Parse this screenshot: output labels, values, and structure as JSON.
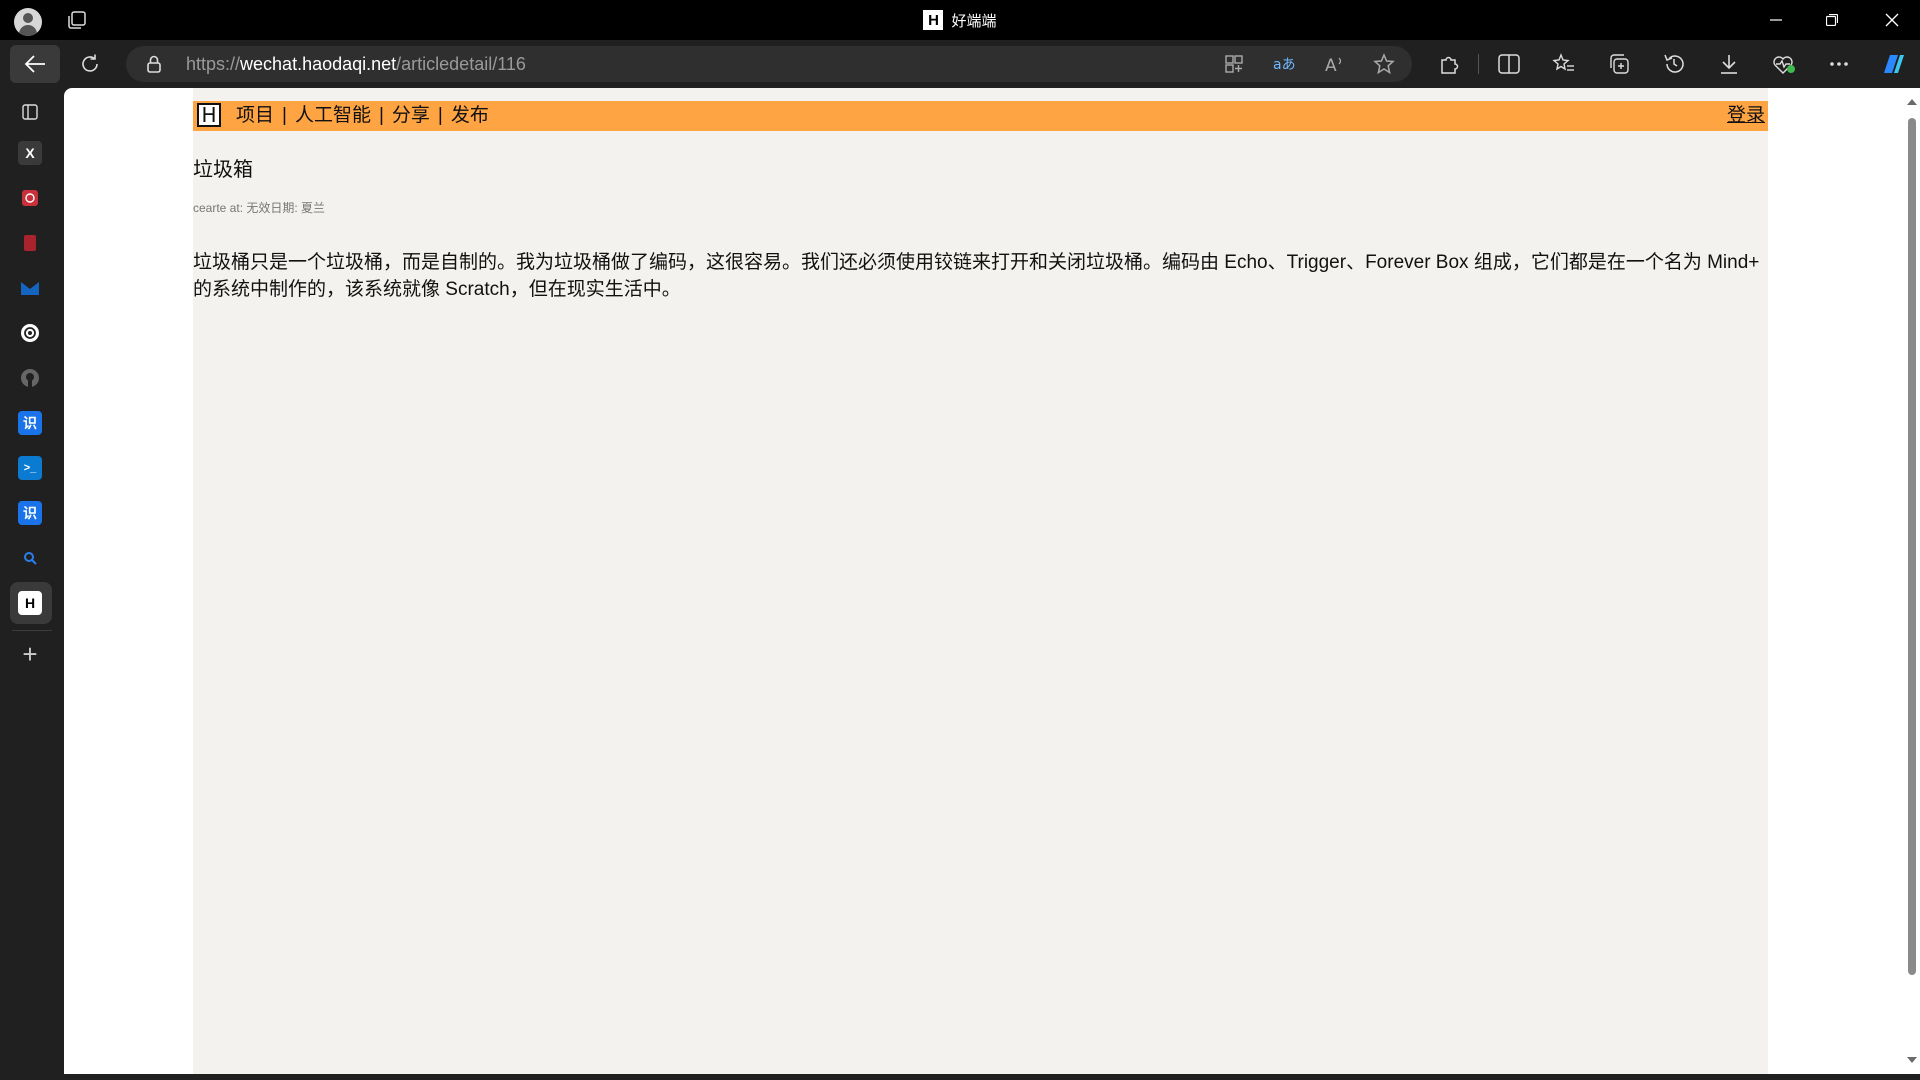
{
  "window": {
    "title": "好端端",
    "favicon_letter": "H"
  },
  "toolbar": {
    "url_scheme": "https://",
    "url_host": "wechat.haodaqi.net",
    "url_path": "/articledetail/116"
  },
  "sidebar": {
    "items": [
      {
        "icon": "sidebar-panel-icon"
      },
      {
        "icon": "x-twitter-icon",
        "glyph": "X"
      },
      {
        "icon": "red-app-icon"
      },
      {
        "icon": "red-book-icon"
      },
      {
        "icon": "mail-icon"
      },
      {
        "icon": "chatgpt-icon"
      },
      {
        "icon": "github-icon"
      },
      {
        "icon": "translate-icon",
        "glyph": "识"
      },
      {
        "icon": "terminal-icon",
        "glyph": ">_"
      },
      {
        "icon": "translate-icon-2",
        "glyph": "识"
      },
      {
        "icon": "search-icon"
      },
      {
        "icon": "haoduanduan-icon",
        "glyph": "H"
      },
      {
        "icon": "add-icon",
        "glyph": "+"
      }
    ]
  },
  "page": {
    "nav": {
      "logo": "H",
      "links": [
        "项目",
        "人工智能",
        "分享",
        "发布"
      ],
      "separator": "|",
      "login": "登录"
    },
    "article": {
      "title": "垃圾箱",
      "meta": "cearte at:  无效日期: 夏兰",
      "body": "垃圾桶只是一个垃圾桶，而是自制的。我为垃圾桶做了编码，这很容易。我们还必须使用铰链来打开和关闭垃圾桶。编码由 Echo、Trigger、Forever Box 组成，它们都是在一个名为 Mind+ 的系统中制作的，该系统就像 Scratch，但在现实生活中。"
    }
  },
  "colors": {
    "nav_bg": "#ffa443",
    "page_bg": "#f4f2ee",
    "browser_bg": "#202020",
    "copilot": "#3b9cff"
  }
}
